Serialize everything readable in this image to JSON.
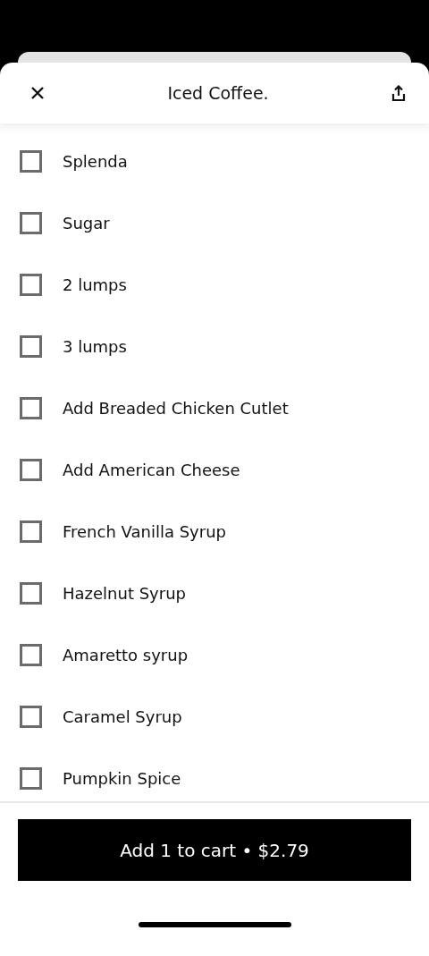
{
  "header": {
    "title": "Iced Coffee."
  },
  "options": [
    {
      "label": "Splenda",
      "checked": false
    },
    {
      "label": "Sugar",
      "checked": false
    },
    {
      "label": "2 lumps",
      "checked": false
    },
    {
      "label": "3 lumps",
      "checked": false
    },
    {
      "label": "Add Breaded Chicken Cutlet",
      "checked": false
    },
    {
      "label": "Add American Cheese",
      "checked": false
    },
    {
      "label": "French Vanilla Syrup",
      "checked": false
    },
    {
      "label": "Hazelnut Syrup",
      "checked": false
    },
    {
      "label": "Amaretto syrup",
      "checked": false
    },
    {
      "label": "Caramel Syrup",
      "checked": false
    },
    {
      "label": "Pumpkin Spice",
      "checked": false
    }
  ],
  "cart_button": {
    "label": "Add 1 to cart • $2.79"
  }
}
